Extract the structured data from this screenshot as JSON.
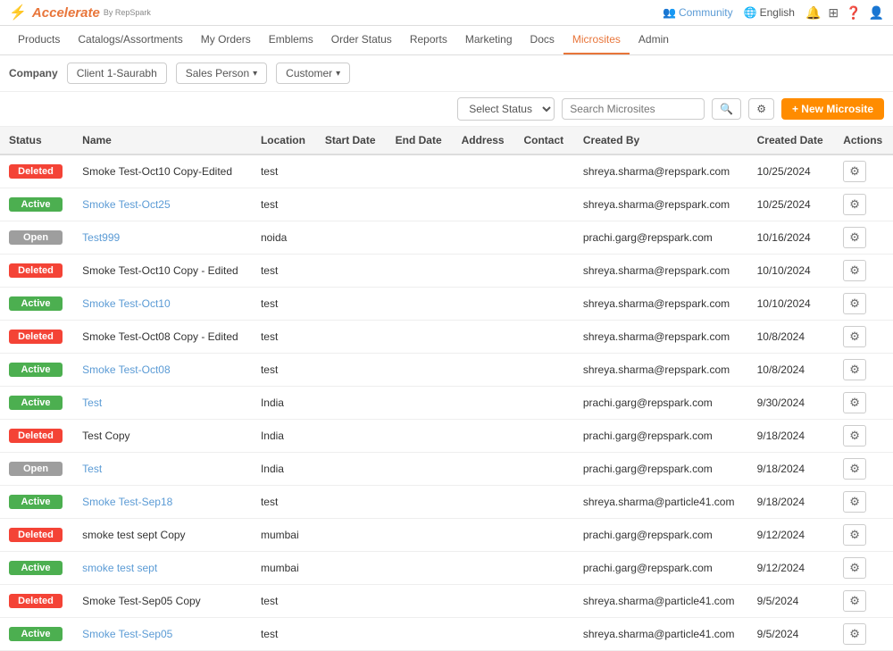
{
  "app": {
    "logo_text": "Accelerate",
    "logo_sub": "By RepSpark"
  },
  "topbar": {
    "community_label": "Community",
    "language_label": "English"
  },
  "nav": {
    "items": [
      {
        "label": "Products",
        "active": false
      },
      {
        "label": "Catalogs/Assortments",
        "active": false
      },
      {
        "label": "My Orders",
        "active": false
      },
      {
        "label": "Emblems",
        "active": false
      },
      {
        "label": "Order Status",
        "active": false
      },
      {
        "label": "Reports",
        "active": false
      },
      {
        "label": "Marketing",
        "active": false
      },
      {
        "label": "Docs",
        "active": false
      },
      {
        "label": "Microsites",
        "active": true
      },
      {
        "label": "Admin",
        "active": false
      }
    ]
  },
  "filters": {
    "company_label": "Company",
    "company_value": "Client 1-Saurabh",
    "sales_person_label": "Sales Person",
    "customer_label": "Customer"
  },
  "toolbar": {
    "select_status_placeholder": "Select Status",
    "search_placeholder": "Search Microsites",
    "new_button_label": "+ New Microsite"
  },
  "table": {
    "columns": [
      "Status",
      "Name",
      "Location",
      "Start Date",
      "End Date",
      "Address",
      "Contact",
      "Created By",
      "Created Date",
      "Actions"
    ],
    "rows": [
      {
        "status": "Deleted",
        "name": "Smoke Test-Oct10 Copy-Edited",
        "name_link": false,
        "location": "test",
        "start_date": "",
        "end_date": "",
        "address": "",
        "contact": "",
        "created_by": "shreya.sharma@repspark.com",
        "created_date": "10/25/2024"
      },
      {
        "status": "Active",
        "name": "Smoke Test-Oct25",
        "name_link": true,
        "location": "test",
        "start_date": "",
        "end_date": "",
        "address": "",
        "contact": "",
        "created_by": "shreya.sharma@repspark.com",
        "created_date": "10/25/2024"
      },
      {
        "status": "Open",
        "name": "Test999",
        "name_link": true,
        "location": "noida",
        "start_date": "",
        "end_date": "",
        "address": "",
        "contact": "",
        "created_by": "prachi.garg@repspark.com",
        "created_date": "10/16/2024"
      },
      {
        "status": "Deleted",
        "name": "Smoke Test-Oct10 Copy - Edited",
        "name_link": false,
        "location": "test",
        "start_date": "",
        "end_date": "",
        "address": "",
        "contact": "",
        "created_by": "shreya.sharma@repspark.com",
        "created_date": "10/10/2024"
      },
      {
        "status": "Active",
        "name": "Smoke Test-Oct10",
        "name_link": true,
        "location": "test",
        "start_date": "",
        "end_date": "",
        "address": "",
        "contact": "",
        "created_by": "shreya.sharma@repspark.com",
        "created_date": "10/10/2024"
      },
      {
        "status": "Deleted",
        "name": "Smoke Test-Oct08 Copy - Edited",
        "name_link": false,
        "location": "test",
        "start_date": "",
        "end_date": "",
        "address": "",
        "contact": "",
        "created_by": "shreya.sharma@repspark.com",
        "created_date": "10/8/2024"
      },
      {
        "status": "Active",
        "name": "Smoke Test-Oct08",
        "name_link": true,
        "location": "test",
        "start_date": "",
        "end_date": "",
        "address": "",
        "contact": "",
        "created_by": "shreya.sharma@repspark.com",
        "created_date": "10/8/2024"
      },
      {
        "status": "Active",
        "name": "Test",
        "name_link": true,
        "location": "India",
        "start_date": "",
        "end_date": "",
        "address": "",
        "contact": "",
        "created_by": "prachi.garg@repspark.com",
        "created_date": "9/30/2024"
      },
      {
        "status": "Deleted",
        "name": "Test Copy",
        "name_link": false,
        "location": "India",
        "start_date": "",
        "end_date": "",
        "address": "",
        "contact": "",
        "created_by": "prachi.garg@repspark.com",
        "created_date": "9/18/2024"
      },
      {
        "status": "Open",
        "name": "Test",
        "name_link": true,
        "location": "India",
        "start_date": "",
        "end_date": "",
        "address": "",
        "contact": "",
        "created_by": "prachi.garg@repspark.com",
        "created_date": "9/18/2024"
      },
      {
        "status": "Active",
        "name": "Smoke Test-Sep18",
        "name_link": true,
        "location": "test",
        "start_date": "",
        "end_date": "",
        "address": "",
        "contact": "",
        "created_by": "shreya.sharma@particle41.com",
        "created_date": "9/18/2024"
      },
      {
        "status": "Deleted",
        "name": "smoke test sept Copy",
        "name_link": false,
        "location": "mumbai",
        "start_date": "",
        "end_date": "",
        "address": "",
        "contact": "",
        "created_by": "prachi.garg@repspark.com",
        "created_date": "9/12/2024"
      },
      {
        "status": "Active",
        "name": "smoke test sept",
        "name_link": true,
        "location": "mumbai",
        "start_date": "",
        "end_date": "",
        "address": "",
        "contact": "",
        "created_by": "prachi.garg@repspark.com",
        "created_date": "9/12/2024"
      },
      {
        "status": "Deleted",
        "name": "Smoke Test-Sep05 Copy",
        "name_link": false,
        "location": "test",
        "start_date": "",
        "end_date": "",
        "address": "",
        "contact": "",
        "created_by": "shreya.sharma@particle41.com",
        "created_date": "9/5/2024"
      },
      {
        "status": "Active",
        "name": "Smoke Test-Sep05",
        "name_link": true,
        "location": "test",
        "start_date": "",
        "end_date": "",
        "address": "",
        "contact": "",
        "created_by": "shreya.sharma@particle41.com",
        "created_date": "9/5/2024"
      }
    ]
  }
}
